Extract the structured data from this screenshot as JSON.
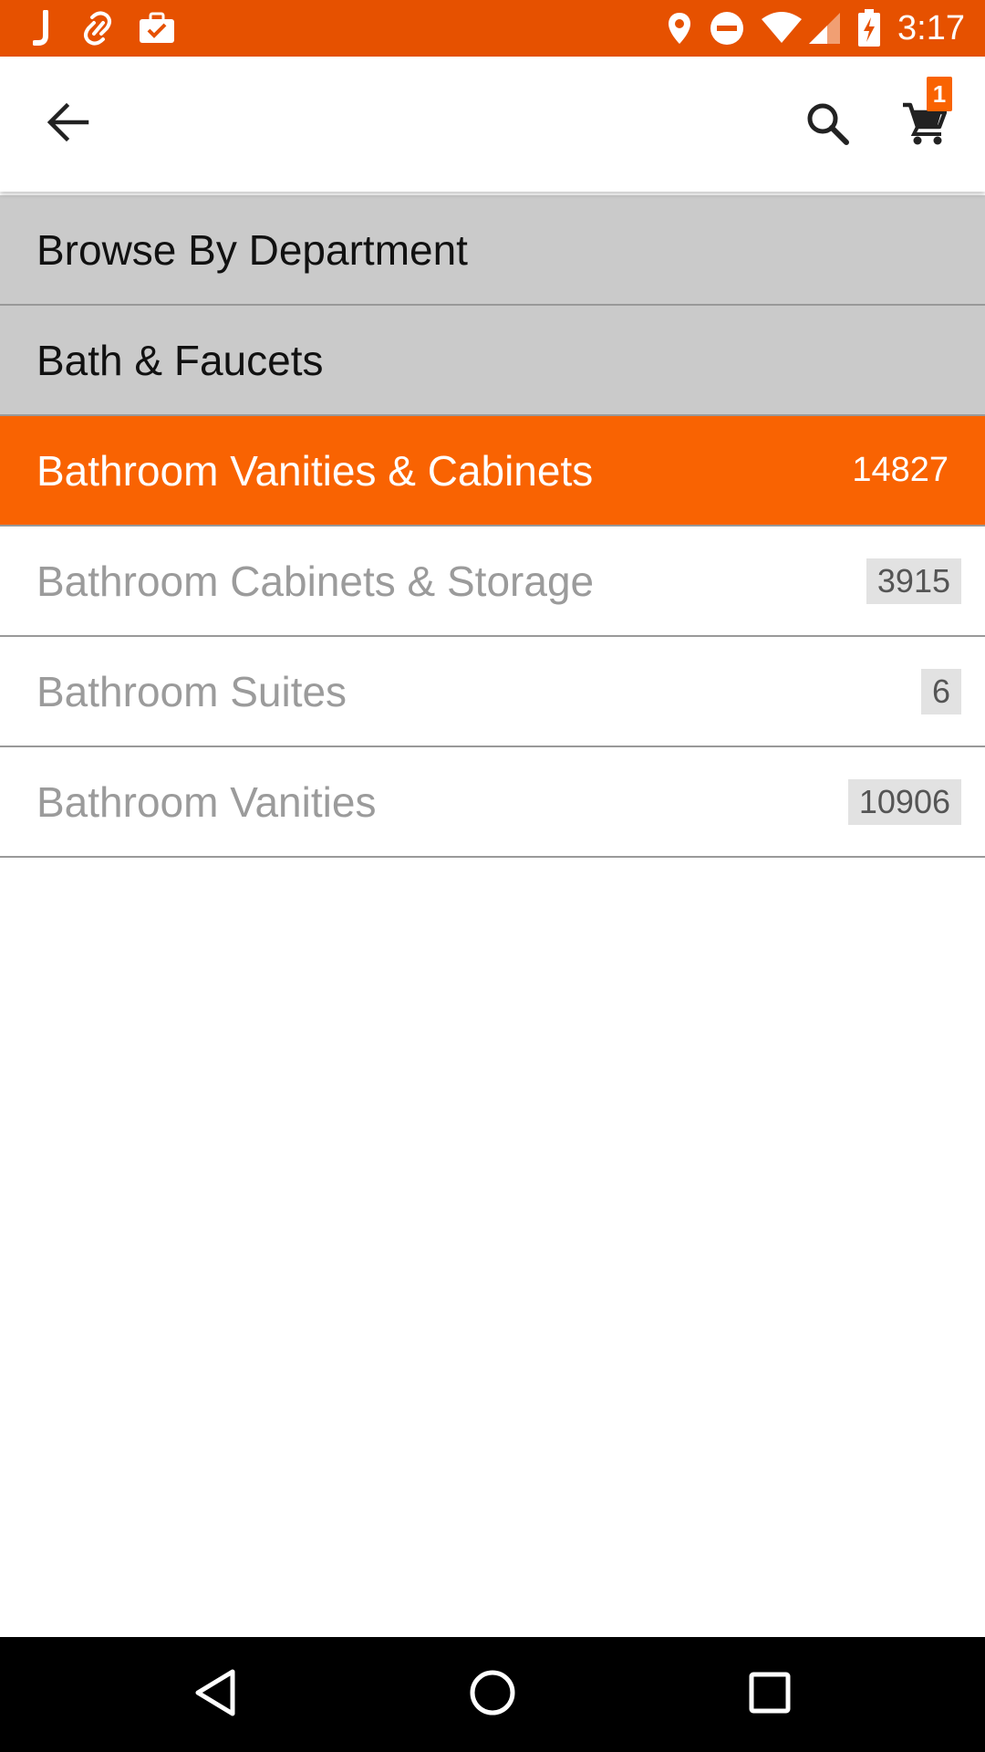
{
  "status_bar": {
    "time": "3:17",
    "left_icons": [
      "notification-j-icon",
      "link-icon",
      "briefcase-check-icon"
    ],
    "right_icons": [
      "location-icon",
      "do-not-disturb-icon",
      "wifi-icon",
      "signal-icon",
      "battery-charging-icon"
    ],
    "background": "#e65100"
  },
  "app_bar": {
    "back_icon": "arrow-left-icon",
    "search_icon": "search-icon",
    "cart_icon": "cart-icon",
    "cart_badge": "1"
  },
  "list": {
    "headers": [
      {
        "label": "Browse By Department"
      },
      {
        "label": "Bath & Faucets"
      }
    ],
    "selected": {
      "label": "Bathroom Vanities & Cabinets",
      "count": "14827"
    },
    "items": [
      {
        "label": "Bathroom Cabinets & Storage",
        "count": "3915"
      },
      {
        "label": "Bathroom Suites",
        "count": "6"
      },
      {
        "label": "Bathroom Vanities",
        "count": "10906"
      }
    ]
  },
  "nav_bar": {
    "back": "nav-back-icon",
    "home": "nav-home-icon",
    "recents": "nav-recents-icon"
  },
  "colors": {
    "accent": "#f96302",
    "status_bar": "#e65100",
    "header_row": "#cacaca",
    "muted_text": "#9b9b9b"
  }
}
